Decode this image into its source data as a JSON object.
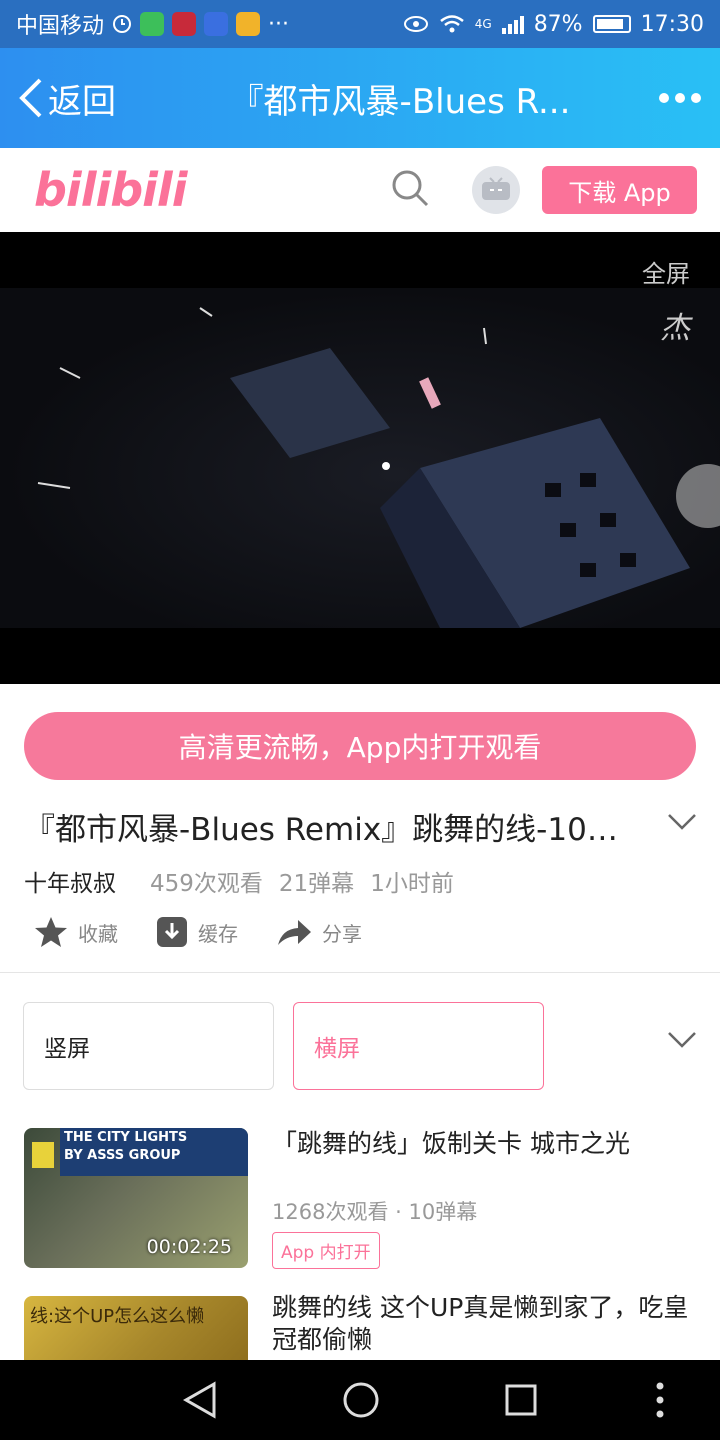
{
  "status_bar": {
    "carrier": "中国移动",
    "network": "4G",
    "battery": "87%",
    "battery_level": 0.87,
    "time": "17:30",
    "more": "···"
  },
  "nav": {
    "back_label": "返回",
    "title": "『都市风暴-Blues R..."
  },
  "header": {
    "logo": "bilibili",
    "download_label": "下载 App",
    "brand_color": "#fb7299"
  },
  "player": {
    "fullscreen_label": "全屏"
  },
  "open_app_label": "高清更流畅，App内打开观看",
  "video": {
    "title": "『都市风暴-Blues Remix』跳舞的线-108...",
    "author": "十年叔叔",
    "views": "459次观看",
    "danmaku": "21弹幕",
    "time_ago": "1小时前"
  },
  "actions": [
    {
      "label": "收藏",
      "icon": "star-icon"
    },
    {
      "label": "缓存",
      "icon": "download-icon"
    },
    {
      "label": "分享",
      "icon": "share-icon"
    }
  ],
  "segments": {
    "portrait": "竖屏",
    "landscape": "横屏"
  },
  "related": [
    {
      "title": "「跳舞的线」饭制关卡 城市之光",
      "stats": "1268次观看 · 10弹幕",
      "duration": "00:02:25",
      "thumb_line1": "THE CITY LIGHTS",
      "thumb_line2": "BY ASSS GROUP",
      "app_label": "App 内打开"
    },
    {
      "title": "跳舞的线 这个UP真是懒到家了，吃皇冠都偷懒",
      "thumb_caption": "线:这个UP怎么这么懒"
    }
  ]
}
